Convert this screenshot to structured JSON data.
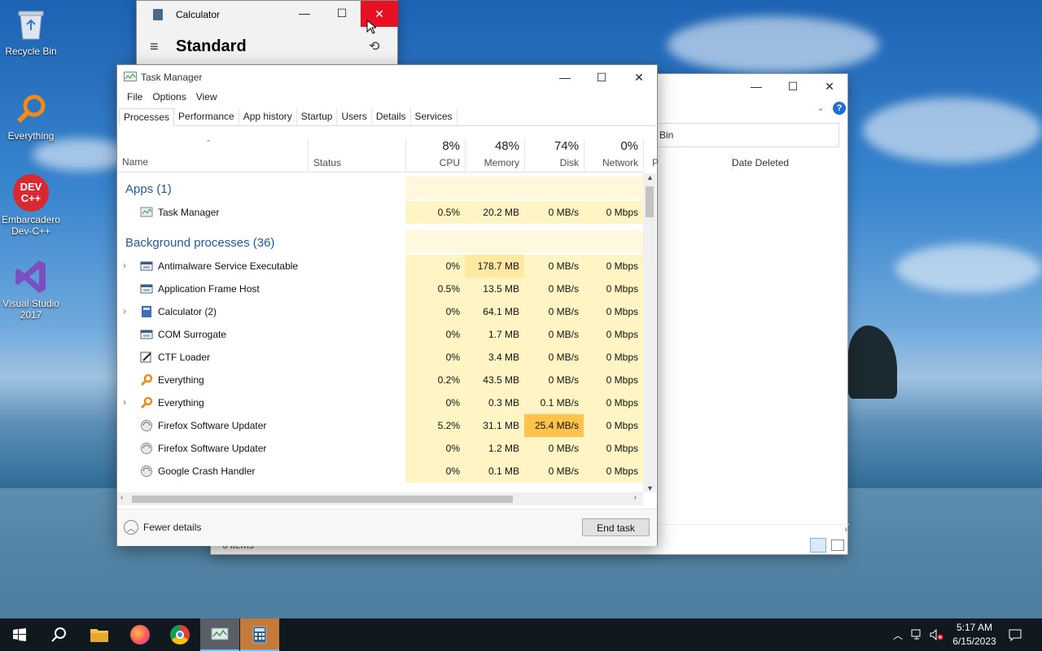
{
  "desktop": {
    "icons": [
      {
        "label": "Recycle Bin"
      },
      {
        "label": "Everything"
      },
      {
        "label": "Embarcadero Dev-C++"
      },
      {
        "label": "Visual Studio 2017"
      }
    ]
  },
  "calculator": {
    "title": "Calculator",
    "mode": "Standard"
  },
  "recycle_bin": {
    "address_tail": "Bin",
    "column": "Date Deleted",
    "status": "0 items"
  },
  "task_manager": {
    "title": "Task Manager",
    "menu": [
      "File",
      "Options",
      "View"
    ],
    "tabs": [
      "Processes",
      "Performance",
      "App history",
      "Startup",
      "Users",
      "Details",
      "Services"
    ],
    "active_tab": "Processes",
    "columns": {
      "name": "Name",
      "status": "Status",
      "cpu": {
        "pct": "8%",
        "label": "CPU"
      },
      "memory": {
        "pct": "48%",
        "label": "Memory"
      },
      "disk": {
        "pct": "74%",
        "label": "Disk"
      },
      "network": {
        "pct": "0%",
        "label": "Network"
      },
      "power_partial": "P"
    },
    "groups": {
      "apps": "Apps (1)",
      "background": "Background processes (36)"
    },
    "apps": [
      {
        "name": "Task Manager",
        "cpu": "0.5%",
        "memory": "20.2 MB",
        "disk": "0 MB/s",
        "network": "0 Mbps"
      }
    ],
    "processes": [
      {
        "name": "Antimalware Service Executable",
        "expand": true,
        "cpu": "0%",
        "memory": "178.7 MB",
        "disk": "0 MB/s",
        "network": "0 Mbps"
      },
      {
        "name": "Application Frame Host",
        "expand": false,
        "cpu": "0.5%",
        "memory": "13.5 MB",
        "disk": "0 MB/s",
        "network": "0 Mbps"
      },
      {
        "name": "Calculator (2)",
        "expand": true,
        "cpu": "0%",
        "memory": "64.1 MB",
        "disk": "0 MB/s",
        "network": "0 Mbps"
      },
      {
        "name": "COM Surrogate",
        "expand": false,
        "cpu": "0%",
        "memory": "1.7 MB",
        "disk": "0 MB/s",
        "network": "0 Mbps"
      },
      {
        "name": "CTF Loader",
        "expand": false,
        "cpu": "0%",
        "memory": "3.4 MB",
        "disk": "0 MB/s",
        "network": "0 Mbps"
      },
      {
        "name": "Everything",
        "expand": false,
        "cpu": "0.2%",
        "memory": "43.5 MB",
        "disk": "0 MB/s",
        "network": "0 Mbps"
      },
      {
        "name": "Everything",
        "expand": true,
        "cpu": "0%",
        "memory": "0.3 MB",
        "disk": "0.1 MB/s",
        "network": "0 Mbps"
      },
      {
        "name": "Firefox Software Updater",
        "expand": false,
        "cpu": "5.2%",
        "memory": "31.1 MB",
        "disk": "25.4 MB/s",
        "network": "0 Mbps"
      },
      {
        "name": "Firefox Software Updater",
        "expand": false,
        "cpu": "0%",
        "memory": "1.2 MB",
        "disk": "0 MB/s",
        "network": "0 Mbps"
      },
      {
        "name": "Google Crash Handler",
        "expand": false,
        "cpu": "0%",
        "memory": "0.1 MB",
        "disk": "0 MB/s",
        "network": "0 Mbps"
      }
    ],
    "footer": {
      "fewer_details": "Fewer details",
      "end_task": "End task"
    }
  },
  "taskbar": {
    "time": "5:17 AM",
    "date": "6/15/2023"
  },
  "colors": {
    "heat_light": "#fff4c4",
    "heat_mid": "#ffe8a0",
    "heat_hot": "#ffd27a",
    "heat_very_hot": "#ffc24a",
    "close_red": "#e81123",
    "group_blue": "#1e5aa8"
  }
}
